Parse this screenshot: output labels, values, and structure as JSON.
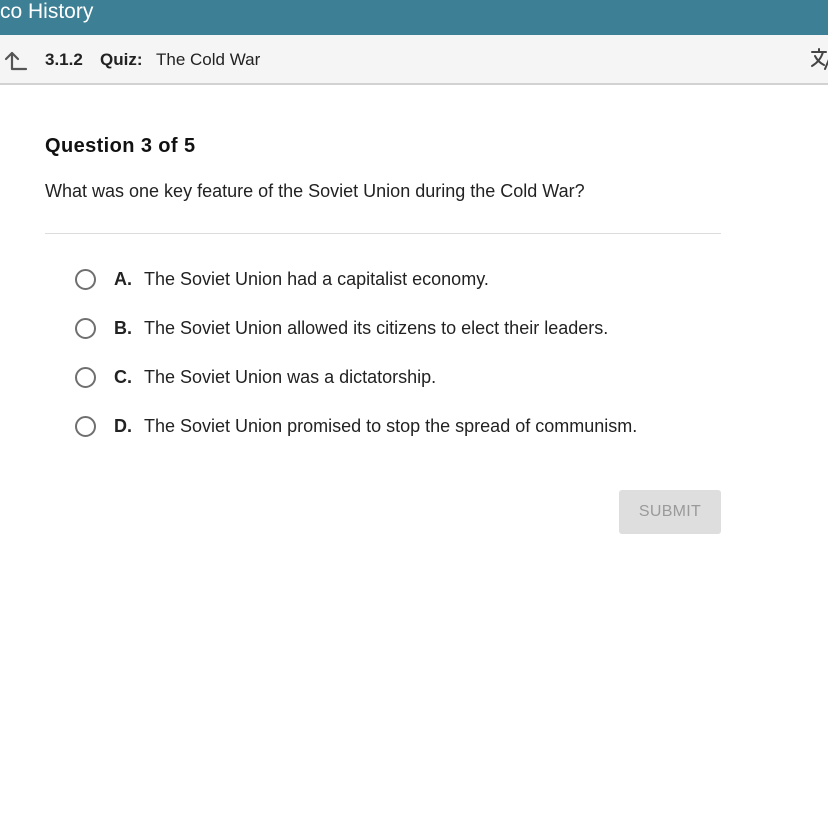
{
  "header": {
    "app_title": "co History"
  },
  "breadcrumb": {
    "back_icon": "back-arrow-icon",
    "lesson_number": "3.1.2",
    "type": "Quiz:",
    "title": "The Cold War",
    "translate_icon": "translate-icon"
  },
  "question": {
    "heading": "Question 3 of 5",
    "text": "What was one key feature of the Soviet Union during the Cold War?"
  },
  "options": [
    {
      "letter": "A.",
      "text": "The Soviet Union had a capitalist economy."
    },
    {
      "letter": "B.",
      "text": "The Soviet Union allowed its citizens to elect their leaders."
    },
    {
      "letter": "C.",
      "text": "The Soviet Union was a dictatorship."
    },
    {
      "letter": "D.",
      "text": "The Soviet Union promised to stop the spread of communism."
    }
  ],
  "submit": {
    "label": "SUBMIT",
    "enabled": false
  },
  "colors": {
    "header_bg": "#3d7f94",
    "breadcrumb_bg": "#f5f5f5",
    "submit_disabled_bg": "#dedede",
    "submit_disabled_text": "#9a9a9a"
  }
}
